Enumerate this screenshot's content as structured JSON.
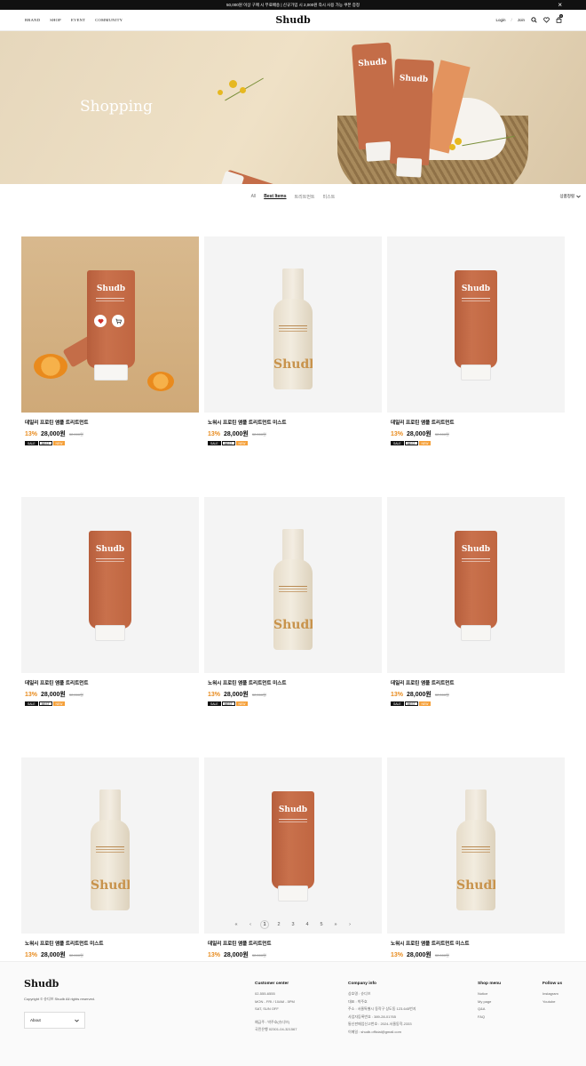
{
  "announcement": {
    "text": "50,000원 이상 구매 시 무료배송 | 신규가입 시 2,000원 즉시 사용 가능 쿠폰 증정",
    "close_icon": "×"
  },
  "header": {
    "nav": [
      "BRAND",
      "SHOP",
      "EVENT",
      "COMMUNITY"
    ],
    "logo": "Shudb",
    "login": "Login",
    "join": "Join",
    "separator": "/",
    "icons": [
      "search-icon",
      "heart-icon",
      "bag-icon"
    ],
    "cart_count": "0"
  },
  "hero": {
    "title": "Shopping",
    "tube_brand": "Shudb"
  },
  "tabs": {
    "items": [
      "All",
      "Best Items",
      "트리트먼트",
      "미스트"
    ],
    "active_index": 1,
    "sort_label": "상품정렬",
    "sort_icon": "chevron-down-icon"
  },
  "products": [
    {
      "type": "scene",
      "name": "데일리 프로틴 앰플 트리트먼트",
      "discount": "13%",
      "price": "28,000원",
      "original": "32,000원",
      "brand": "Shudb",
      "badges": [
        "SALE",
        "BEST",
        "NEW"
      ]
    },
    {
      "type": "bottle",
      "name": "노워시 프로틴 앰플 트리트먼트 미스트",
      "discount": "13%",
      "price": "28,000원",
      "original": "32,000원",
      "brand": "Shudb",
      "badges": [
        "SALE",
        "BEST",
        "NEW"
      ]
    },
    {
      "type": "tube",
      "name": "데일리 프로틴 앰플 트리트먼트",
      "discount": "13%",
      "price": "28,000원",
      "original": "32,000원",
      "brand": "Shudb",
      "badges": [
        "SALE",
        "BEST",
        "NEW"
      ]
    },
    {
      "type": "tube",
      "name": "데일리 프로틴 앰플 트리트먼트",
      "discount": "13%",
      "price": "28,000원",
      "original": "32,000원",
      "brand": "Shudb",
      "badges": [
        "SALE",
        "BEST",
        "NEW"
      ]
    },
    {
      "type": "bottle",
      "name": "노워시 프로틴 앰플 트리트먼트 미스트",
      "discount": "13%",
      "price": "28,000원",
      "original": "32,000원",
      "brand": "Shudb",
      "badges": [
        "SALE",
        "BEST",
        "NEW"
      ]
    },
    {
      "type": "tube",
      "name": "데일리 프로틴 앰플 트리트먼트",
      "discount": "13%",
      "price": "28,000원",
      "original": "32,000원",
      "brand": "Shudb",
      "badges": [
        "SALE",
        "BEST",
        "NEW"
      ]
    },
    {
      "type": "bottle",
      "name": "노워시 프로틴 앰플 트리트먼트 미스트",
      "discount": "13%",
      "price": "28,000원",
      "original": "32,000원",
      "brand": "Shudb",
      "badges": [
        "SALE",
        "BEST",
        "NEW"
      ]
    },
    {
      "type": "tube",
      "name": "데일리 프로틴 앰플 트리트먼트",
      "discount": "13%",
      "price": "28,000원",
      "original": "32,000원",
      "brand": "Shudb",
      "badges": [
        "SALE",
        "BEST",
        "NEW"
      ]
    },
    {
      "type": "bottle",
      "name": "노워시 프로틴 앰플 트리트먼트 미스트",
      "discount": "13%",
      "price": "28,000원",
      "original": "32,000원",
      "brand": "Shudb",
      "badges": [
        "SALE",
        "BEST",
        "NEW"
      ]
    }
  ],
  "pagination": {
    "first": "«",
    "prev": "‹",
    "pages": [
      "1",
      "2",
      "3",
      "4",
      "5"
    ],
    "current": "1",
    "next": "»",
    "last": "›"
  },
  "footer": {
    "logo": "Shudb",
    "copyright": "Copyright © 슈디브 Shudb All rights reserved.",
    "select_value": "About",
    "customer": {
      "title": "Customer center",
      "lines": [
        "02-555-6555",
        "MON - FRI / 10AM - 5PM",
        "SAT, SUN OFF",
        "",
        "예금주 : 박주호(슈디브)",
        "국민은행 02301-04-321567"
      ]
    },
    "company": {
      "title": "Company info",
      "lines": [
        "상호명 : 슈디브",
        "대표 : 박주호",
        "주소 : 서울특별시 동작구 상도동 123-645번지",
        "사업자등록번호 : 389-28-01765",
        "통신판매업신고번호 : 2024-서울동작-2333",
        "이메일 : shudb.official@gmail.com"
      ]
    },
    "shop": {
      "title": "Shop menu",
      "lines": [
        "Notice",
        "My page",
        "Q&A",
        "FAQ"
      ]
    },
    "follow": {
      "title": "Follow us",
      "lines": [
        "Instagram",
        "Youtube"
      ]
    }
  },
  "colors": {
    "accent": "#e88b1d",
    "tube": "#c46d48",
    "badge_new": "#f5a039"
  }
}
